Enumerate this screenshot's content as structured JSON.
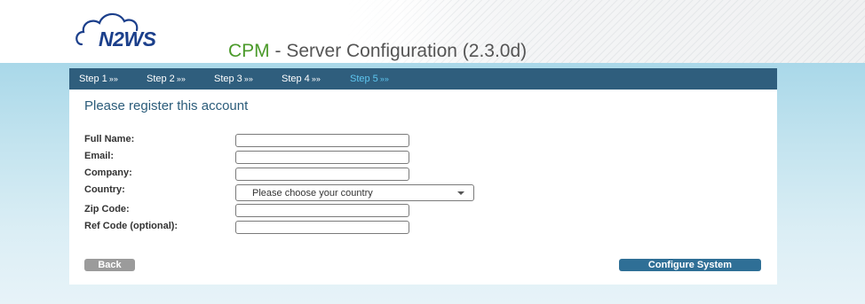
{
  "header": {
    "logo_text": "N2WS",
    "title_brand": "CPM",
    "title_rest": " - Server Configuration (2.3.0d)"
  },
  "steps": [
    {
      "label": "Step 1",
      "arrows": "»»",
      "active": false
    },
    {
      "label": "Step 2",
      "arrows": "»»",
      "active": false
    },
    {
      "label": "Step 3",
      "arrows": "»»",
      "active": false
    },
    {
      "label": "Step 4",
      "arrows": "»»",
      "active": false
    },
    {
      "label": "Step 5",
      "arrows": "»»",
      "active": true
    }
  ],
  "form": {
    "heading": "Please register this account",
    "full_name": {
      "label": "Full Name:",
      "value": ""
    },
    "email": {
      "label": "Email:",
      "value": ""
    },
    "company": {
      "label": "Company:",
      "value": ""
    },
    "country": {
      "label": "Country:",
      "selected": "Please choose your country"
    },
    "zip_code": {
      "label": "Zip Code:",
      "value": ""
    },
    "ref_code": {
      "label": "Ref Code (optional):",
      "value": ""
    }
  },
  "buttons": {
    "back": "Back",
    "configure": "Configure System"
  },
  "colors": {
    "steps_bar": "#2f5e7d",
    "active_step": "#5ec6f0",
    "brand_green": "#4b9a2a",
    "logo_blue": "#1b3f8b",
    "configure_button": "#2f6f96",
    "back_button": "#9b9b9b"
  }
}
